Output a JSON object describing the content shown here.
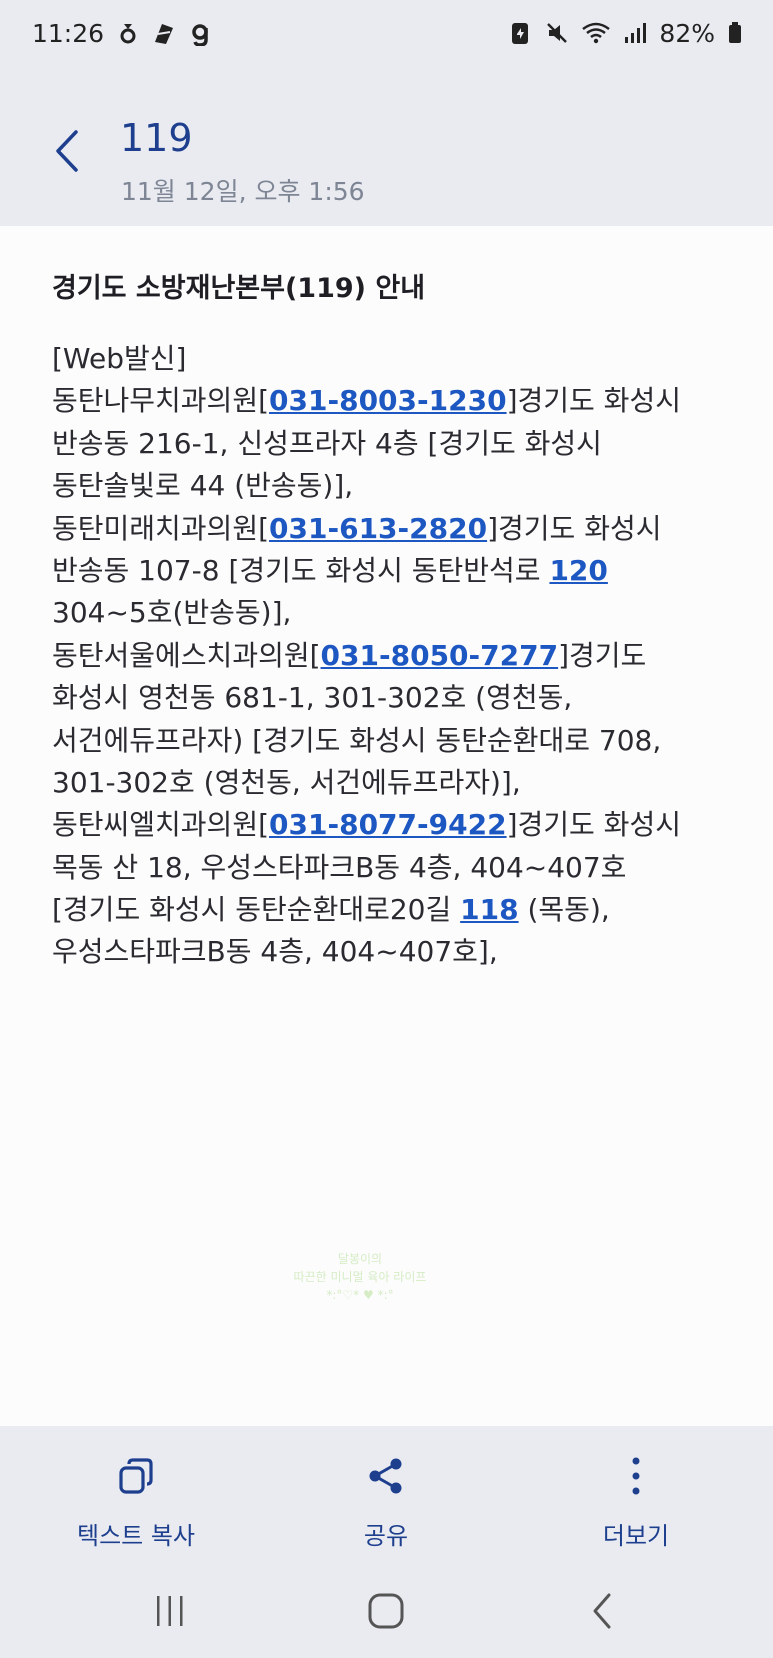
{
  "status_bar": {
    "time": "11:26",
    "battery": "82%"
  },
  "header": {
    "title": "119",
    "date": "11월 12일, 오후 1:56"
  },
  "message": {
    "title": "경기도 소방재난본부(119) 안내",
    "lines": [
      [
        {
          "t": "[Web발신]"
        }
      ],
      [
        {
          "t": "동탄나무치과의원["
        },
        {
          "t": "031-8003-1230",
          "link": true
        },
        {
          "t": "]경기도 화성시"
        }
      ],
      [
        {
          "t": "반송동 216-1, 신성프라자 4층 [경기도 화성시"
        }
      ],
      [
        {
          "t": "동탄솔빛로 44  (반송동)],"
        }
      ],
      [
        {
          "t": "동탄미래치과의원["
        },
        {
          "t": "031-613-2820",
          "link": true
        },
        {
          "t": "]경기도 화성시"
        }
      ],
      [
        {
          "t": "반송동 107-8 [경기도 화성시 동탄반석로 "
        },
        {
          "t": "120",
          "link": true
        }
      ],
      [
        {
          "t": "304~5호(반송동)],"
        }
      ],
      [
        {
          "t": "동탄서울에스치과의원["
        },
        {
          "t": "031-8050-7277",
          "link": true
        },
        {
          "t": "]경기도"
        }
      ],
      [
        {
          "t": "화성시 영천동 681-1, 301-302호 (영천동,"
        }
      ],
      [
        {
          "t": "서건에듀프라자) [경기도 화성시 동탄순환대로 708,"
        }
      ],
      [
        {
          "t": "301-302호 (영천동, 서건에듀프라자)],"
        }
      ],
      [
        {
          "t": "동탄씨엘치과의원["
        },
        {
          "t": "031-8077-9422",
          "link": true
        },
        {
          "t": "]경기도 화성시"
        }
      ],
      [
        {
          "t": "목동 산 18, 우성스타파크B동 4층,  404~407호"
        }
      ],
      [
        {
          "t": "[경기도 화성시 동탄순환대로20길 "
        },
        {
          "t": "118",
          "link": true
        },
        {
          "t": "  (목동),"
        }
      ],
      [
        {
          "t": "우성스타파크B동 4층,  404~407호],"
        }
      ]
    ]
  },
  "watermark": {
    "line1": "달봉이의",
    "line2": "따끈한 미니멀 육아 라이프",
    "line3": "*:°♡* ♥ *:°"
  },
  "actions": {
    "copy_label": "텍스트 복사",
    "share_label": "공유",
    "more_label": "더보기"
  },
  "colors": {
    "accent": "#1d3f8e",
    "link": "#1d57c2",
    "bar_bg": "#e9ebf1"
  }
}
